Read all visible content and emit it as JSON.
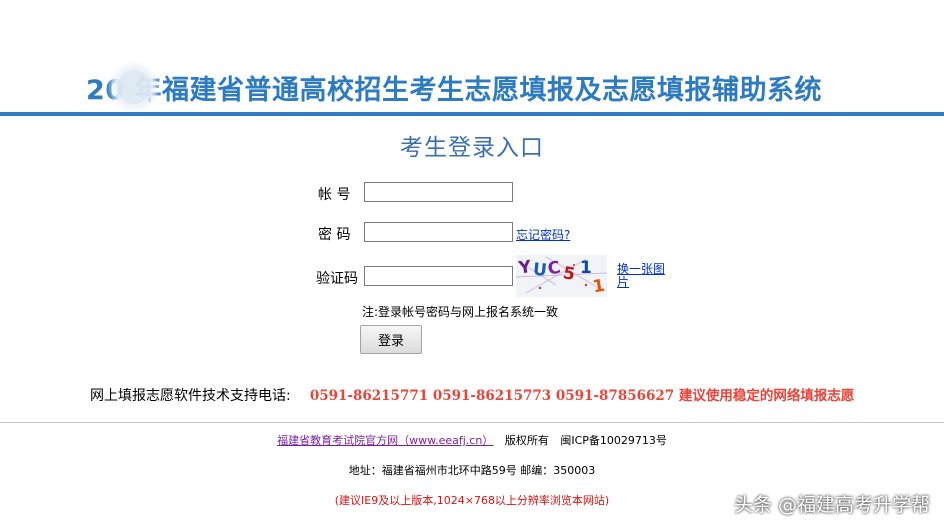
{
  "header": {
    "title": "20  年福建省普通高校招生考生志愿填报及志愿填报辅助系统",
    "accent_color": "#2d7bc0"
  },
  "login": {
    "title": "考生登录入口",
    "account_label": "帐  号",
    "account_value": "",
    "password_label": "密  码",
    "password_value": "",
    "forgot_password_link": "忘记密码?",
    "captcha_label": "验证码",
    "captcha_value": "",
    "captcha_image_text": "YUC51 1",
    "refresh_captcha_link": "换一张图片",
    "note": "注:登录帐号密码与网上报名系统一致",
    "login_button": "登录"
  },
  "support": {
    "label": "网上填报志愿软件技术支持电话:",
    "phones": "0591-86215771 0591-86215773 0591-87856627 建议使用稳定的网络填报志愿",
    "phones_color": "#e8443a"
  },
  "footer": {
    "org_link": "福建省教育考试院官方网（www.eeafj.cn）",
    "copyright": "版权所有",
    "icp": "闽ICP备10029713号",
    "address": "地址：福建省福州市北环中路59号  邮编：350003",
    "browser_note": "(建议IE9及以上版本,1024×768以上分辨率浏览本网站)"
  },
  "watermark": {
    "text": "头条 @福建高考升学帮"
  }
}
